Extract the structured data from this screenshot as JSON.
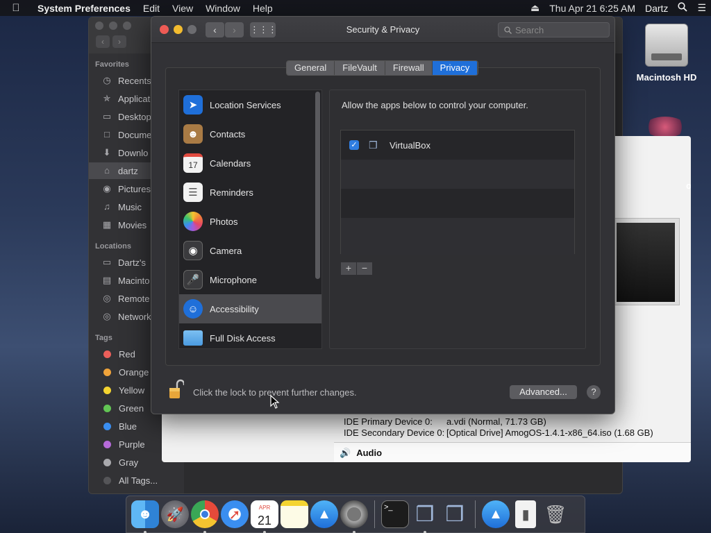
{
  "menubar": {
    "app_name": "System Preferences",
    "items": [
      "Edit",
      "View",
      "Window",
      "Help"
    ],
    "clock": "Thu Apr 21  6:25 AM",
    "user": "Dartz"
  },
  "desktop": {
    "hd_label": "Macintosh HD"
  },
  "finder": {
    "favorites_label": "Favorites",
    "favorites": [
      "Recents",
      "Applicat",
      "Desktop",
      "Docume",
      "Downlo",
      "dartz",
      "Pictures",
      "Music",
      "Movies"
    ],
    "locations_label": "Locations",
    "locations": [
      "Dartz's",
      "Macinto",
      "Remote",
      "Network"
    ],
    "tags_label": "Tags",
    "tags": [
      {
        "name": "Red",
        "color": "#ec5f5a"
      },
      {
        "name": "Orange",
        "color": "#f0a33a"
      },
      {
        "name": "Yellow",
        "color": "#f4d430"
      },
      {
        "name": "Green",
        "color": "#62c554"
      },
      {
        "name": "Blue",
        "color": "#3a8ef0"
      },
      {
        "name": "Purple",
        "color": "#b66ad9"
      },
      {
        "name": "Gray",
        "color": "#a9a9ad"
      },
      {
        "name": "All Tags...",
        "color": "#555558"
      }
    ]
  },
  "vbox": {
    "partial_text": "om",
    "storage_rows": [
      {
        "label": "IDE Primary Device 0:",
        "value": "a.vdi (Normal, 71.73 GB)"
      },
      {
        "label": "IDE Secondary Device 0:",
        "value": "[Optical Drive] AmogOS-1.4.1-x86_64.iso (1.68 GB)"
      }
    ],
    "audio_label": "Audio"
  },
  "prefs": {
    "window_title": "Security & Privacy",
    "search_placeholder": "Search",
    "tabs": [
      {
        "label": "General",
        "active": false
      },
      {
        "label": "FileVault",
        "active": false
      },
      {
        "label": "Firewall",
        "active": false
      },
      {
        "label": "Privacy",
        "active": true
      }
    ],
    "categories": [
      {
        "label": "Location Services",
        "icon": "location-arrow-icon",
        "color": "#1f6fd9"
      },
      {
        "label": "Contacts",
        "icon": "contacts-book-icon",
        "color": "#a97b45"
      },
      {
        "label": "Calendars",
        "icon": "calendar-icon",
        "color": "#f2f2f2"
      },
      {
        "label": "Reminders",
        "icon": "reminders-list-icon",
        "color": "#f2f2f2"
      },
      {
        "label": "Photos",
        "icon": "photos-flower-icon",
        "color": "#f2f2f2"
      },
      {
        "label": "Camera",
        "icon": "camera-icon",
        "color": "#3a3a3d"
      },
      {
        "label": "Microphone",
        "icon": "microphone-icon",
        "color": "#3a3a3d"
      },
      {
        "label": "Accessibility",
        "icon": "accessibility-icon",
        "color": "#1f6fd9",
        "selected": true
      },
      {
        "label": "Full Disk Access",
        "icon": "folder-icon",
        "color": "#5aa7e6"
      }
    ],
    "calendar_day": "17",
    "allow_text": "Allow the apps below to control your computer.",
    "apps": [
      {
        "name": "VirtualBox",
        "checked": true
      }
    ],
    "add_label": "+",
    "remove_label": "−",
    "lock_text": "Click the lock to prevent further changes.",
    "advanced_label": "Advanced...",
    "help_label": "?"
  },
  "dock": {
    "calendar_month": "APR",
    "calendar_day": "21",
    "apps": [
      "finder",
      "launchpad",
      "chrome",
      "safari",
      "calendar",
      "notes",
      "app-store",
      "system-preferences",
      "terminal",
      "virtualbox",
      "virtualbox-vm",
      "app-store-downloads",
      "archive",
      "trash"
    ]
  }
}
